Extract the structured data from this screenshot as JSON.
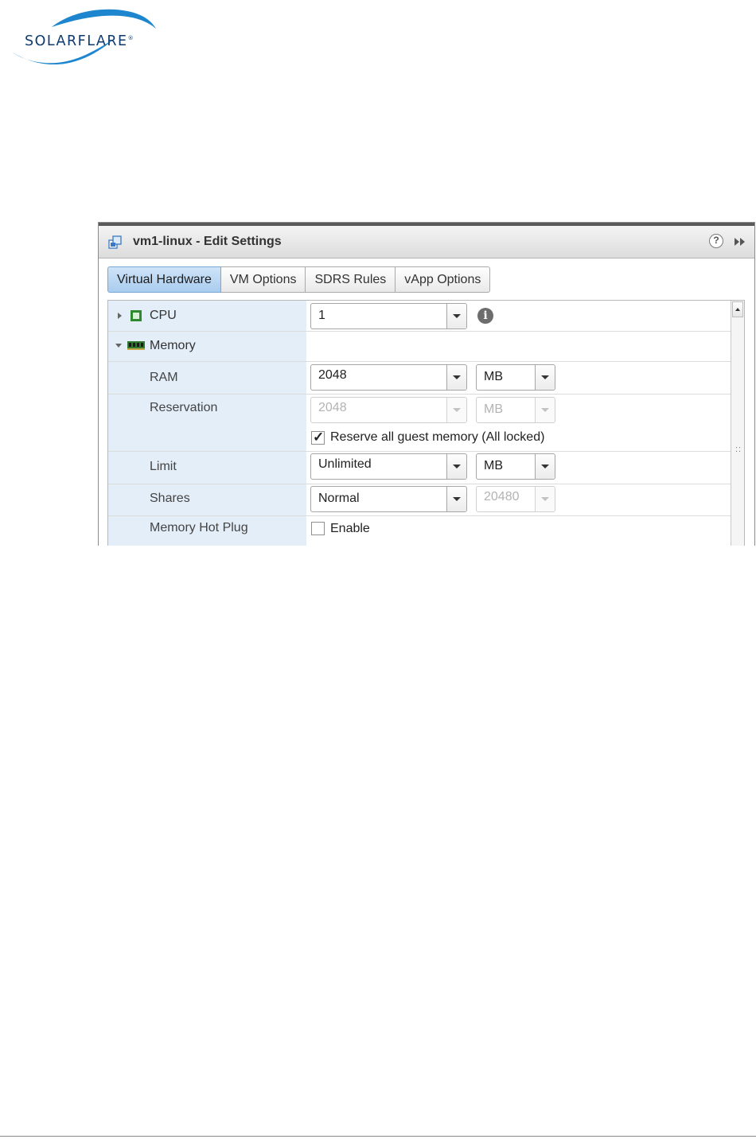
{
  "logo": {
    "text": "SOLARFLARE",
    "mark": "®"
  },
  "dialog": {
    "title": "vm1-linux - Edit Settings",
    "help_icon": "?",
    "tabs": [
      {
        "label": "Virtual Hardware",
        "active": true
      },
      {
        "label": "VM Options",
        "active": false
      },
      {
        "label": "SDRS Rules",
        "active": false
      },
      {
        "label": "vApp Options",
        "active": false
      }
    ]
  },
  "hardware": {
    "cpu": {
      "label": "CPU",
      "value": "1",
      "info_icon": "i"
    },
    "memory": {
      "label": "Memory",
      "ram": {
        "label": "RAM",
        "value": "2048",
        "unit": "MB"
      },
      "reservation": {
        "label": "Reservation",
        "value": "2048",
        "unit": "MB",
        "reserve_all_label": "Reserve all guest memory (All locked)",
        "reserve_all_checked": true
      },
      "limit": {
        "label": "Limit",
        "value": "Unlimited",
        "unit": "MB"
      },
      "shares": {
        "label": "Shares",
        "value": "Normal",
        "count": "20480"
      },
      "hot_plug": {
        "label": "Memory Hot Plug",
        "enable_label": "Enable",
        "checked": false
      }
    }
  },
  "colors": {
    "accent_tab": "#a9ccef",
    "label_column": "#e4eef8",
    "brand_blue": "#1f7fc4",
    "brand_text": "#0e3a6e"
  }
}
